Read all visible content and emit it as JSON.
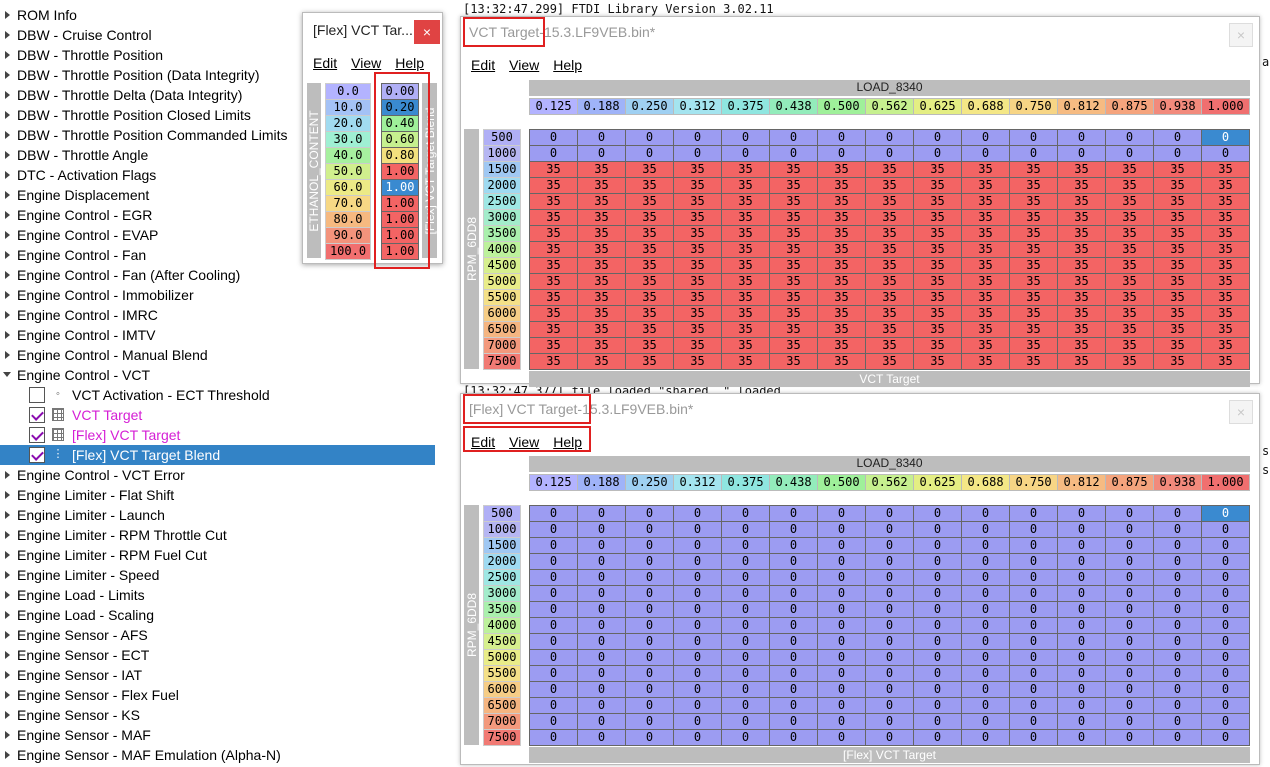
{
  "tree": {
    "items": [
      {
        "label": "ROM Info",
        "type": "folder"
      },
      {
        "label": "DBW - Cruise Control",
        "type": "folder"
      },
      {
        "label": "DBW - Throttle Position",
        "type": "folder"
      },
      {
        "label": "DBW - Throttle Position (Data Integrity)",
        "type": "folder"
      },
      {
        "label": "DBW - Throttle Delta (Data Integrity)",
        "type": "folder"
      },
      {
        "label": "DBW - Throttle Position Closed Limits",
        "type": "folder"
      },
      {
        "label": "DBW - Throttle Position Commanded Limits",
        "type": "folder"
      },
      {
        "label": "DBW - Throttle Angle",
        "type": "folder"
      },
      {
        "label": "DTC - Activation Flags",
        "type": "folder"
      },
      {
        "label": "Engine Displacement",
        "type": "folder"
      },
      {
        "label": "Engine Control - EGR",
        "type": "folder"
      },
      {
        "label": "Engine Control - EVAP",
        "type": "folder"
      },
      {
        "label": "Engine Control - Fan",
        "type": "folder"
      },
      {
        "label": "Engine Control - Fan (After Cooling)",
        "type": "folder"
      },
      {
        "label": "Engine Control - Immobilizer",
        "type": "folder"
      },
      {
        "label": "Engine Control - IMRC",
        "type": "folder"
      },
      {
        "label": "Engine Control - IMTV",
        "type": "folder"
      },
      {
        "label": "Engine Control - Manual Blend",
        "type": "folder"
      },
      {
        "label": "Engine Control - VCT",
        "type": "folder",
        "open": true
      },
      {
        "label": "VCT Activation - ECT Threshold",
        "type": "child",
        "checked": false,
        "icon": "dot"
      },
      {
        "label": "VCT Target",
        "type": "child",
        "checked": true,
        "icon": "grid",
        "pink": true
      },
      {
        "label": "[Flex] VCT Target",
        "type": "child",
        "checked": true,
        "icon": "grid",
        "pink": true
      },
      {
        "label": "[Flex] VCT Target Blend",
        "type": "child",
        "checked": true,
        "icon": "column",
        "selected": true
      },
      {
        "label": "Engine Control - VCT Error",
        "type": "folder"
      },
      {
        "label": "Engine Limiter - Flat Shift",
        "type": "folder"
      },
      {
        "label": "Engine Limiter - Launch",
        "type": "folder"
      },
      {
        "label": "Engine Limiter - RPM Throttle Cut",
        "type": "folder"
      },
      {
        "label": "Engine Limiter - RPM Fuel Cut",
        "type": "folder"
      },
      {
        "label": "Engine Limiter - Speed",
        "type": "folder"
      },
      {
        "label": "Engine Load - Limits",
        "type": "folder"
      },
      {
        "label": "Engine Load - Scaling",
        "type": "folder"
      },
      {
        "label": "Engine Sensor - AFS",
        "type": "folder"
      },
      {
        "label": "Engine Sensor - ECT",
        "type": "folder"
      },
      {
        "label": "Engine Sensor - IAT",
        "type": "folder"
      },
      {
        "label": "Engine Sensor - Flex Fuel",
        "type": "folder"
      },
      {
        "label": "Engine Sensor - KS",
        "type": "folder"
      },
      {
        "label": "Engine Sensor - MAF",
        "type": "folder"
      },
      {
        "label": "Engine Sensor - MAF Emulation (Alpha-N)",
        "type": "folder"
      }
    ]
  },
  "log": {
    "line1": "[13:32:47.299] FTDI Library Version 3.02.11",
    "line2": "[13:32:47.377] file loaded \"shared..\" loaded",
    "right_cut1": "a",
    "right_cut2": "s",
    "right_cut3": "s"
  },
  "blend_window": {
    "title": "[Flex] VCT Tar...",
    "close": "×",
    "menu": [
      "Edit",
      "View",
      "Help"
    ],
    "axis_label": "ETHANOL_CONTENT",
    "table_label": "[Flex] VCT Target Blend",
    "axis_values": [
      "0.0",
      "10.0",
      "20.0",
      "30.0",
      "40.0",
      "50.0",
      "60.0",
      "70.0",
      "80.0",
      "90.0",
      "100.0"
    ],
    "values": [
      "0.00",
      "0.20",
      "0.40",
      "0.60",
      "0.80",
      "1.00",
      "1.00",
      "1.00",
      "1.00",
      "1.00",
      "1.00"
    ]
  },
  "windows": [
    {
      "title_part1": "VCT Target",
      "title_part2": "-15.3.LF9VEB.bin*",
      "close": "×",
      "menu": [
        "Edit",
        "View",
        "Help"
      ],
      "x_axis_name": "LOAD_8340",
      "y_axis_name": "RPM_6DD8",
      "table_name": "VCT Target",
      "x_values": [
        "0.125",
        "0.188",
        "0.250",
        "0.312",
        "0.375",
        "0.438",
        "0.500",
        "0.562",
        "0.625",
        "0.688",
        "0.750",
        "0.812",
        "0.875",
        "0.938",
        "1.000"
      ],
      "y_values": [
        "500",
        "1000",
        "1500",
        "2000",
        "2500",
        "3000",
        "3500",
        "4000",
        "4500",
        "5000",
        "5500",
        "6000",
        "6500",
        "7000",
        "7500"
      ],
      "cells": [
        [
          "0",
          "0",
          "0",
          "0",
          "0",
          "0",
          "0",
          "0",
          "0",
          "0",
          "0",
          "0",
          "0",
          "0",
          "0"
        ],
        [
          "0",
          "0",
          "0",
          "0",
          "0",
          "0",
          "0",
          "0",
          "0",
          "0",
          "0",
          "0",
          "0",
          "0",
          "0"
        ],
        [
          "35",
          "35",
          "35",
          "35",
          "35",
          "35",
          "35",
          "35",
          "35",
          "35",
          "35",
          "35",
          "35",
          "35",
          "35"
        ],
        [
          "35",
          "35",
          "35",
          "35",
          "35",
          "35",
          "35",
          "35",
          "35",
          "35",
          "35",
          "35",
          "35",
          "35",
          "35"
        ],
        [
          "35",
          "35",
          "35",
          "35",
          "35",
          "35",
          "35",
          "35",
          "35",
          "35",
          "35",
          "35",
          "35",
          "35",
          "35"
        ],
        [
          "35",
          "35",
          "35",
          "35",
          "35",
          "35",
          "35",
          "35",
          "35",
          "35",
          "35",
          "35",
          "35",
          "35",
          "35"
        ],
        [
          "35",
          "35",
          "35",
          "35",
          "35",
          "35",
          "35",
          "35",
          "35",
          "35",
          "35",
          "35",
          "35",
          "35",
          "35"
        ],
        [
          "35",
          "35",
          "35",
          "35",
          "35",
          "35",
          "35",
          "35",
          "35",
          "35",
          "35",
          "35",
          "35",
          "35",
          "35"
        ],
        [
          "35",
          "35",
          "35",
          "35",
          "35",
          "35",
          "35",
          "35",
          "35",
          "35",
          "35",
          "35",
          "35",
          "35",
          "35"
        ],
        [
          "35",
          "35",
          "35",
          "35",
          "35",
          "35",
          "35",
          "35",
          "35",
          "35",
          "35",
          "35",
          "35",
          "35",
          "35"
        ],
        [
          "35",
          "35",
          "35",
          "35",
          "35",
          "35",
          "35",
          "35",
          "35",
          "35",
          "35",
          "35",
          "35",
          "35",
          "35"
        ],
        [
          "35",
          "35",
          "35",
          "35",
          "35",
          "35",
          "35",
          "35",
          "35",
          "35",
          "35",
          "35",
          "35",
          "35",
          "35"
        ],
        [
          "35",
          "35",
          "35",
          "35",
          "35",
          "35",
          "35",
          "35",
          "35",
          "35",
          "35",
          "35",
          "35",
          "35",
          "35"
        ],
        [
          "35",
          "35",
          "35",
          "35",
          "35",
          "35",
          "35",
          "35",
          "35",
          "35",
          "35",
          "35",
          "35",
          "35",
          "35"
        ],
        [
          "35",
          "35",
          "35",
          "35",
          "35",
          "35",
          "35",
          "35",
          "35",
          "35",
          "35",
          "35",
          "35",
          "35",
          "35"
        ]
      ]
    },
    {
      "title_part1": "[Flex] VCT Target",
      "title_part2": "-15.3.LF9VEB.bin*",
      "close": "×",
      "menu": [
        "Edit",
        "View",
        "Help"
      ],
      "x_axis_name": "LOAD_8340",
      "y_axis_name": "RPM_6DD8",
      "table_name": "[Flex] VCT Target",
      "x_values": [
        "0.125",
        "0.188",
        "0.250",
        "0.312",
        "0.375",
        "0.438",
        "0.500",
        "0.562",
        "0.625",
        "0.688",
        "0.750",
        "0.812",
        "0.875",
        "0.938",
        "1.000"
      ],
      "y_values": [
        "500",
        "1000",
        "1500",
        "2000",
        "2500",
        "3000",
        "3500",
        "4000",
        "4500",
        "5000",
        "5500",
        "6000",
        "6500",
        "7000",
        "7500"
      ],
      "cells": [
        [
          "0",
          "0",
          "0",
          "0",
          "0",
          "0",
          "0",
          "0",
          "0",
          "0",
          "0",
          "0",
          "0",
          "0",
          "0"
        ],
        [
          "0",
          "0",
          "0",
          "0",
          "0",
          "0",
          "0",
          "0",
          "0",
          "0",
          "0",
          "0",
          "0",
          "0",
          "0"
        ],
        [
          "0",
          "0",
          "0",
          "0",
          "0",
          "0",
          "0",
          "0",
          "0",
          "0",
          "0",
          "0",
          "0",
          "0",
          "0"
        ],
        [
          "0",
          "0",
          "0",
          "0",
          "0",
          "0",
          "0",
          "0",
          "0",
          "0",
          "0",
          "0",
          "0",
          "0",
          "0"
        ],
        [
          "0",
          "0",
          "0",
          "0",
          "0",
          "0",
          "0",
          "0",
          "0",
          "0",
          "0",
          "0",
          "0",
          "0",
          "0"
        ],
        [
          "0",
          "0",
          "0",
          "0",
          "0",
          "0",
          "0",
          "0",
          "0",
          "0",
          "0",
          "0",
          "0",
          "0",
          "0"
        ],
        [
          "0",
          "0",
          "0",
          "0",
          "0",
          "0",
          "0",
          "0",
          "0",
          "0",
          "0",
          "0",
          "0",
          "0",
          "0"
        ],
        [
          "0",
          "0",
          "0",
          "0",
          "0",
          "0",
          "0",
          "0",
          "0",
          "0",
          "0",
          "0",
          "0",
          "0",
          "0"
        ],
        [
          "0",
          "0",
          "0",
          "0",
          "0",
          "0",
          "0",
          "0",
          "0",
          "0",
          "0",
          "0",
          "0",
          "0",
          "0"
        ],
        [
          "0",
          "0",
          "0",
          "0",
          "0",
          "0",
          "0",
          "0",
          "0",
          "0",
          "0",
          "0",
          "0",
          "0",
          "0"
        ],
        [
          "0",
          "0",
          "0",
          "0",
          "0",
          "0",
          "0",
          "0",
          "0",
          "0",
          "0",
          "0",
          "0",
          "0",
          "0"
        ],
        [
          "0",
          "0",
          "0",
          "0",
          "0",
          "0",
          "0",
          "0",
          "0",
          "0",
          "0",
          "0",
          "0",
          "0",
          "0"
        ],
        [
          "0",
          "0",
          "0",
          "0",
          "0",
          "0",
          "0",
          "0",
          "0",
          "0",
          "0",
          "0",
          "0",
          "0",
          "0"
        ],
        [
          "0",
          "0",
          "0",
          "0",
          "0",
          "0",
          "0",
          "0",
          "0",
          "0",
          "0",
          "0",
          "0",
          "0",
          "0"
        ],
        [
          "0",
          "0",
          "0",
          "0",
          "0",
          "0",
          "0",
          "0",
          "0",
          "0",
          "0",
          "0",
          "0",
          "0",
          "0"
        ]
      ]
    }
  ],
  "colors": {
    "selected_row": "#3383c6",
    "pink_label": "#d51ed5",
    "highlight_box": "#e02020",
    "cell_zero": "#9c9cf2",
    "cell_35": "#f36464",
    "cell_selected": "#3a8ad0",
    "axis_bar": "#bdbdbd",
    "x_scale": [
      "#b3b3ff",
      "#9fb3f8",
      "#9fd0f2",
      "#a4e4ef",
      "#8fe6e0",
      "#93ecbb",
      "#9ff09a",
      "#c6f08f",
      "#e4ee83",
      "#f4e786",
      "#f7d585",
      "#f6bb82",
      "#f5a47d",
      "#f28a7c",
      "#f06f6f"
    ],
    "y_scale": [
      "#b0aff6",
      "#b6b6f2",
      "#a0c8f3",
      "#9fdaf1",
      "#9fe7e4",
      "#a3eccb",
      "#aaf0ad",
      "#bdf19c",
      "#d6ef8e",
      "#e9ec89",
      "#f4e088",
      "#f6cd86",
      "#f5b581",
      "#f3997d",
      "#f17a74"
    ],
    "blend_axis_scale": [
      "#b3b3ff",
      "#a4c2f6",
      "#a1dbf0",
      "#9ff0d3",
      "#a6f09f",
      "#d0ef8d",
      "#ecea86",
      "#f7d885",
      "#f6b980",
      "#f3937c",
      "#f16f6f"
    ]
  }
}
